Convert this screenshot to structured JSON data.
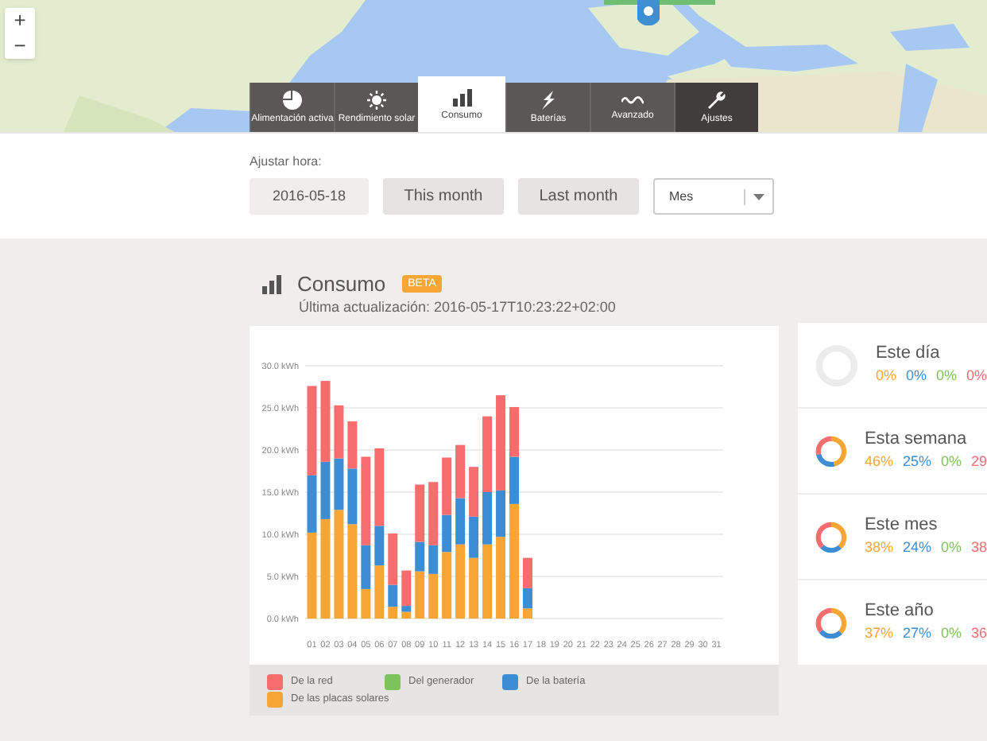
{
  "map": {
    "zoom_controls": [
      "+",
      "−"
    ]
  },
  "tabs": [
    {
      "label": "Alimentación activa",
      "kind": "pie",
      "selected": false,
      "hovered": false
    },
    {
      "label": "Rendimiento solar",
      "kind": "sun",
      "selected": false,
      "hovered": false
    },
    {
      "label": "Consumo",
      "kind": "bars",
      "selected": true,
      "hovered": false
    },
    {
      "label": "Baterías",
      "kind": "bolt",
      "selected": false,
      "hovered": false
    },
    {
      "label": "Avanzado",
      "kind": "wave",
      "selected": false,
      "hovered": false
    },
    {
      "label": "Ajustes",
      "kind": "wrench",
      "selected": false,
      "hovered": true
    }
  ],
  "time_controls": {
    "label": "Ajustar hora:",
    "date": "2016-05-18",
    "buttons": [
      "This month",
      "Last month"
    ],
    "select": "Mes"
  },
  "panel": {
    "title": "Consumo",
    "badge": "BETA",
    "updated": "Última actualización: 2016-05-17T10:23:22+02:00",
    "chart_data": {
      "type": "bar",
      "stacked": true,
      "grid": true,
      "categories": [
        "01",
        "02",
        "03",
        "04",
        "05",
        "06",
        "07",
        "08",
        "09",
        "10",
        "11",
        "12",
        "13",
        "14",
        "15",
        "16",
        "17",
        "18",
        "19",
        "20",
        "21",
        "22",
        "23",
        "24",
        "25",
        "26",
        "27",
        "28",
        "29",
        "30",
        "31"
      ],
      "ylim": [
        0,
        30
      ],
      "yticks": [
        {
          "value": 0,
          "label": "0.0 kWh"
        },
        {
          "value": 5,
          "label": "5.0 kWh"
        },
        {
          "value": 10,
          "label": "10.0 kWh"
        },
        {
          "value": 15,
          "label": "15.0 kWh"
        },
        {
          "value": 20,
          "label": "20.0 kWh"
        },
        {
          "value": 25,
          "label": "25.0 kWh"
        },
        {
          "value": 30,
          "label": "30.0 kWh"
        }
      ],
      "series": [
        {
          "name": "De la red",
          "color": "#f76d6d",
          "values": [
            10.6,
            9.6,
            6.3,
            5.6,
            10.5,
            9.2,
            6.1,
            4.2,
            6.8,
            7.5,
            6.8,
            6.3,
            5.9,
            9.0,
            11.3,
            5.9,
            3.6,
            null,
            null,
            null,
            null,
            null,
            null,
            null,
            null,
            null,
            null,
            null,
            null,
            null,
            null
          ]
        },
        {
          "name": "Del generador",
          "color": "#7dc45a",
          "values": [
            0,
            0,
            0,
            0,
            0,
            0,
            0,
            0,
            0,
            0,
            0,
            0,
            0,
            0,
            0,
            0,
            0,
            null,
            null,
            null,
            null,
            null,
            null,
            null,
            null,
            null,
            null,
            null,
            null,
            null,
            null
          ]
        },
        {
          "name": "De la batería",
          "color": "#3d8dd4",
          "values": [
            6.8,
            6.8,
            6.1,
            6.6,
            5.2,
            4.7,
            2.6,
            0.7,
            3.5,
            3.4,
            4.4,
            5.5,
            4.9,
            6.2,
            5.5,
            5.6,
            2.4,
            null,
            null,
            null,
            null,
            null,
            null,
            null,
            null,
            null,
            null,
            null,
            null,
            null,
            null
          ]
        },
        {
          "name": "De las placas solares",
          "color": "#f7a635",
          "values": [
            10.2,
            11.8,
            12.9,
            11.2,
            3.5,
            6.3,
            1.4,
            0.8,
            5.6,
            5.3,
            7.9,
            8.8,
            7.2,
            8.8,
            9.7,
            13.6,
            1.2,
            null,
            null,
            null,
            null,
            null,
            null,
            null,
            null,
            null,
            null,
            null,
            null,
            null,
            null
          ]
        }
      ]
    }
  },
  "summaries": [
    {
      "label": "Este día",
      "values": [
        {
          "text": "0%",
          "color": "#f7a635"
        },
        {
          "text": "0%",
          "color": "#3d8dd4"
        },
        {
          "text": "0%",
          "color": "#7dc45a"
        },
        {
          "text": "0%",
          "color": "#f76d6d"
        }
      ]
    },
    {
      "label": "Esta semana",
      "values": [
        {
          "text": "46%",
          "color": "#f7a635"
        },
        {
          "text": "25%",
          "color": "#3d8dd4"
        },
        {
          "text": "0%",
          "color": "#7dc45a"
        },
        {
          "text": "29",
          "color": "#f76d6d"
        }
      ]
    },
    {
      "label": "Este mes",
      "values": [
        {
          "text": "38%",
          "color": "#f7a635"
        },
        {
          "text": "24%",
          "color": "#3d8dd4"
        },
        {
          "text": "0%",
          "color": "#7dc45a"
        },
        {
          "text": "38",
          "color": "#f76d6d"
        }
      ]
    },
    {
      "label": "Este año",
      "values": [
        {
          "text": "37%",
          "color": "#f7a635"
        },
        {
          "text": "27%",
          "color": "#3d8dd4"
        },
        {
          "text": "0%",
          "color": "#7dc45a"
        },
        {
          "text": "36",
          "color": "#f76d6d"
        }
      ]
    }
  ]
}
